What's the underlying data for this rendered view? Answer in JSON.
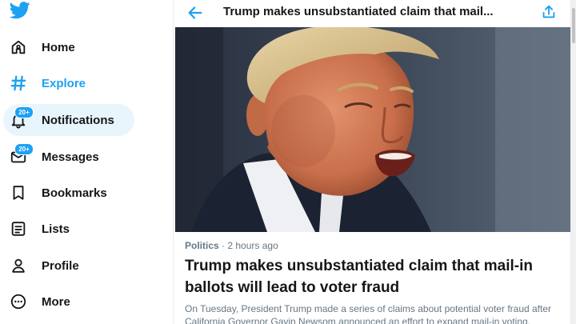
{
  "colors": {
    "accent": "#1da1f2",
    "text": "#14171a",
    "muted": "#657786",
    "active_bg": "#e8f5fd"
  },
  "sidebar": {
    "logo": "twitter-bird-icon",
    "items": [
      {
        "label": "Home",
        "icon": "home-icon"
      },
      {
        "label": "Explore",
        "icon": "hashtag-icon",
        "active": true
      },
      {
        "label": "Notifications",
        "icon": "bell-icon",
        "badge": "20+",
        "highlighted": true
      },
      {
        "label": "Messages",
        "icon": "envelope-icon",
        "badge": "20+"
      },
      {
        "label": "Bookmarks",
        "icon": "bookmark-icon"
      },
      {
        "label": "Lists",
        "icon": "list-icon"
      },
      {
        "label": "Profile",
        "icon": "person-icon"
      },
      {
        "label": "More",
        "icon": "more-circle-icon"
      }
    ]
  },
  "header": {
    "back_icon": "back-arrow-icon",
    "title": "Trump makes unsubstantiated claim that mail...",
    "share_icon": "share-icon"
  },
  "article": {
    "category": "Politics",
    "separator": "·",
    "time": "2 hours ago",
    "headline": "Trump makes unsubstantiated claim that mail-in ballots will lead to voter fraud",
    "summary": "On Tuesday, President Trump made a series of claims about potential voter fraud after California Governor Gavin Newsom announced an effort to expand mail-in voting."
  }
}
